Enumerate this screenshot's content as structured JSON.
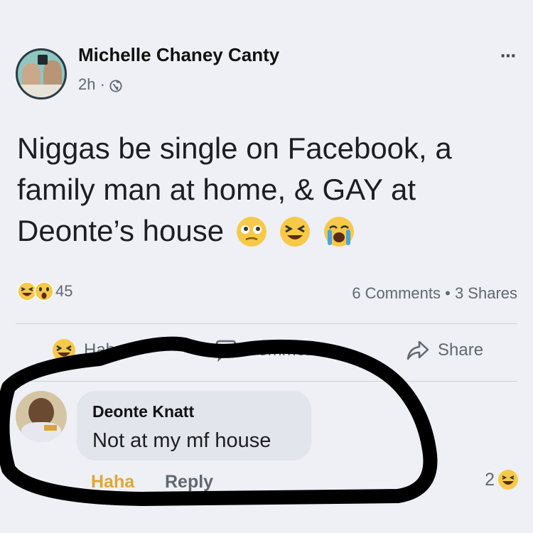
{
  "post": {
    "author": "Michelle Chaney Canty",
    "time": "2h ·",
    "text_line1": "Niggas be single on Facebook, a",
    "text_line2": "family man at home, & GAY at",
    "text_line3": "Deonte’s house",
    "more_icon": "⋯"
  },
  "stats": {
    "reaction_count": "45",
    "comments_shares": "6 Comments • 3 Shares"
  },
  "actions": {
    "haha_label": "Haha",
    "comment_label": "Comment",
    "share_label": "Share"
  },
  "comment": {
    "author": "Deonte Knatt",
    "text": "Not at my mf house",
    "haha_label": "Haha",
    "reply_label": "Reply",
    "reaction_count": "2"
  },
  "colors": {
    "haha_yellow": "#f7c948",
    "marker_black": "#000000",
    "meta_gray": "#606770"
  },
  "icons": {
    "globe": "globe-icon",
    "more": "more-options-icon",
    "share": "share-arrow-icon",
    "comment": "comment-icon",
    "haha": "haha-emoji-icon"
  }
}
